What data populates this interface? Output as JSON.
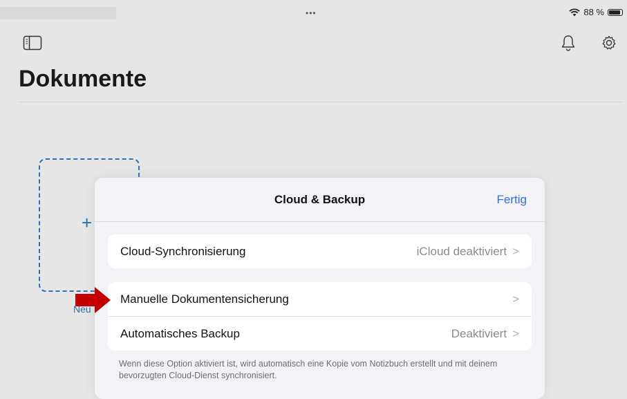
{
  "status_bar": {
    "dots": "•••",
    "battery_text": "88 %"
  },
  "header": {
    "title": "Dokumente",
    "sidebar_icon": "sidebar-icon",
    "bell_icon": "bell-icon",
    "gear_icon": "gear-icon"
  },
  "new_document": {
    "plus": "+",
    "label": "Neu"
  },
  "sheet": {
    "title": "Cloud & Backup",
    "done_label": "Fertig",
    "groups": [
      {
        "rows": [
          {
            "label": "Cloud-Synchronisierung",
            "value": "iCloud deaktiviert"
          }
        ]
      },
      {
        "rows": [
          {
            "label": "Manuelle Dokumentensicherung",
            "value": ""
          },
          {
            "label": "Automatisches Backup",
            "value": "Deaktiviert"
          }
        ]
      }
    ],
    "footnote": "Wenn diese Option aktiviert ist, wird automatisch eine Kopie vom Notizbuch erstellt und mit deinem bevorzugten Cloud-Dienst synchronisiert."
  },
  "colors": {
    "accent": "#2f6fd6",
    "annotation_arrow": "#c40000"
  }
}
